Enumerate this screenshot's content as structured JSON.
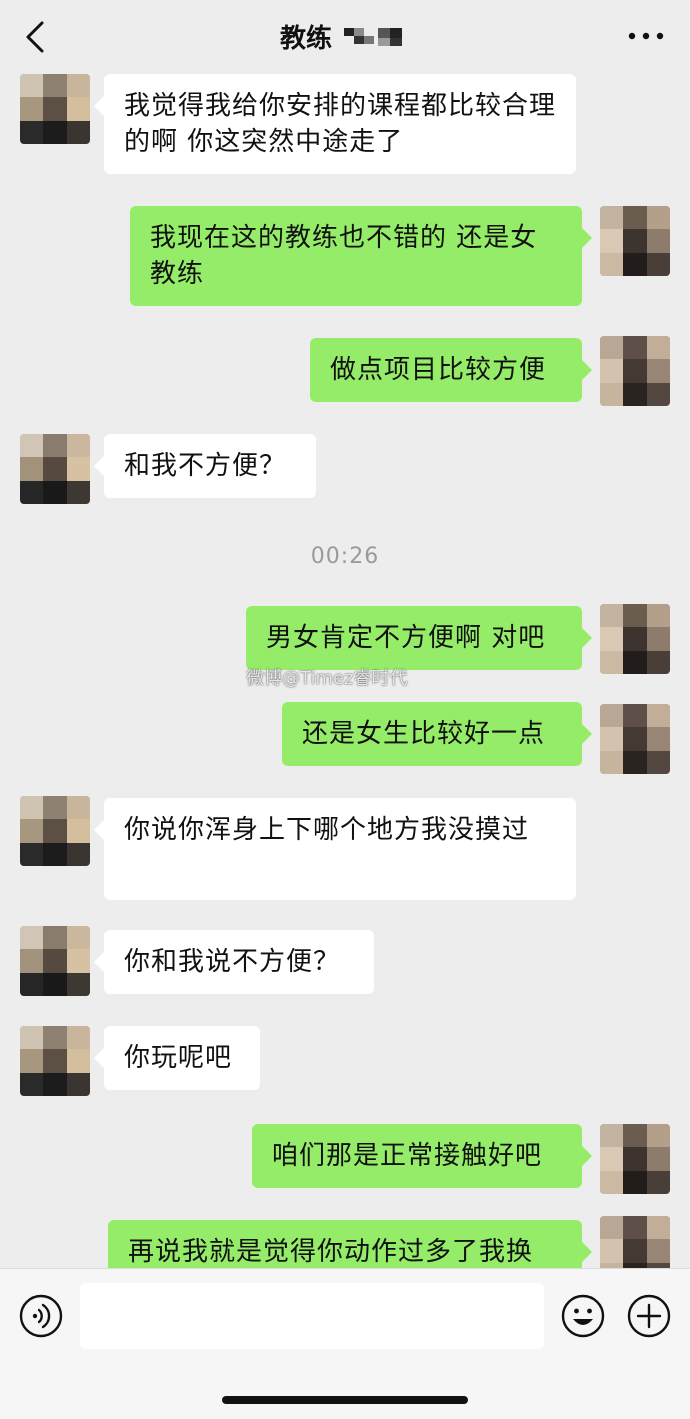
{
  "header": {
    "contact_name": "教练",
    "more_label": "..."
  },
  "chat": {
    "messages": [
      {
        "side": "left",
        "text": "我觉得我给你安排的课程都比较合理的啊 你这突然中途走了"
      },
      {
        "side": "right",
        "text": "我现在这的教练也不错的 还是女教练"
      },
      {
        "side": "right",
        "text": "做点项目比较方便"
      },
      {
        "side": "left",
        "text": "和我不方便？"
      },
      {
        "side": "right",
        "text": "男女肯定不方便啊 对吧"
      },
      {
        "side": "right",
        "text": "还是女生比较好一点"
      },
      {
        "side": "left",
        "text": "你说你浑身上下哪个地方我没摸过"
      },
      {
        "side": "left",
        "text": "你和我说不方便？"
      },
      {
        "side": "left",
        "text": "你玩呢吧"
      },
      {
        "side": "right",
        "text": "咱们那是正常接触好吧"
      },
      {
        "side": "right",
        "text": "再说我就是觉得你动作过多了我换"
      }
    ],
    "timestamp": "00:26",
    "watermark": "微博@Timez睿时代"
  },
  "colors": {
    "background": "#ededed",
    "sent_bubble": "#95ec69",
    "received_bubble": "#ffffff"
  },
  "input_bar": {
    "icons": [
      "voice-icon",
      "emoji-icon",
      "plus-icon"
    ],
    "text_value": ""
  }
}
